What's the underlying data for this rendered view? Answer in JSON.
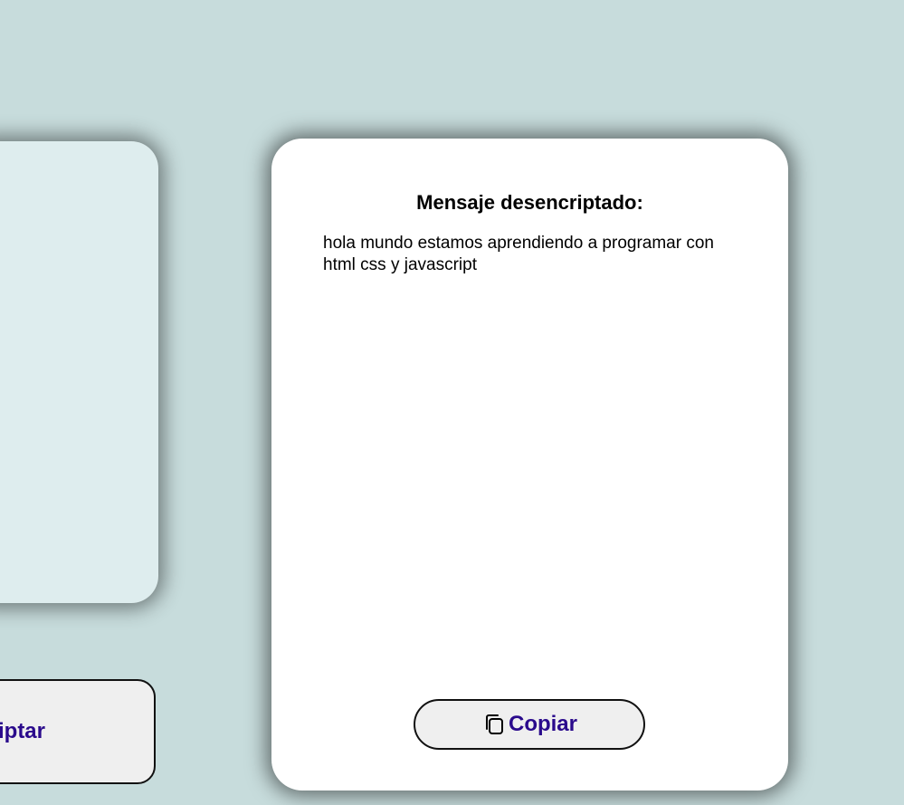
{
  "input_panel": {},
  "decrypt_button": {
    "label": "iptar"
  },
  "output_panel": {
    "title": "Mensaje desencriptado:",
    "message": "hola mundo estamos aprendiendo a programar con html css y javascript",
    "copy_button": {
      "label": "Copiar",
      "icon": "copy-icon"
    }
  },
  "colors": {
    "background": "#c7dcdc",
    "input_panel": "#deedee",
    "button_text": "#2a0a8c",
    "button_bg": "#efefef"
  }
}
